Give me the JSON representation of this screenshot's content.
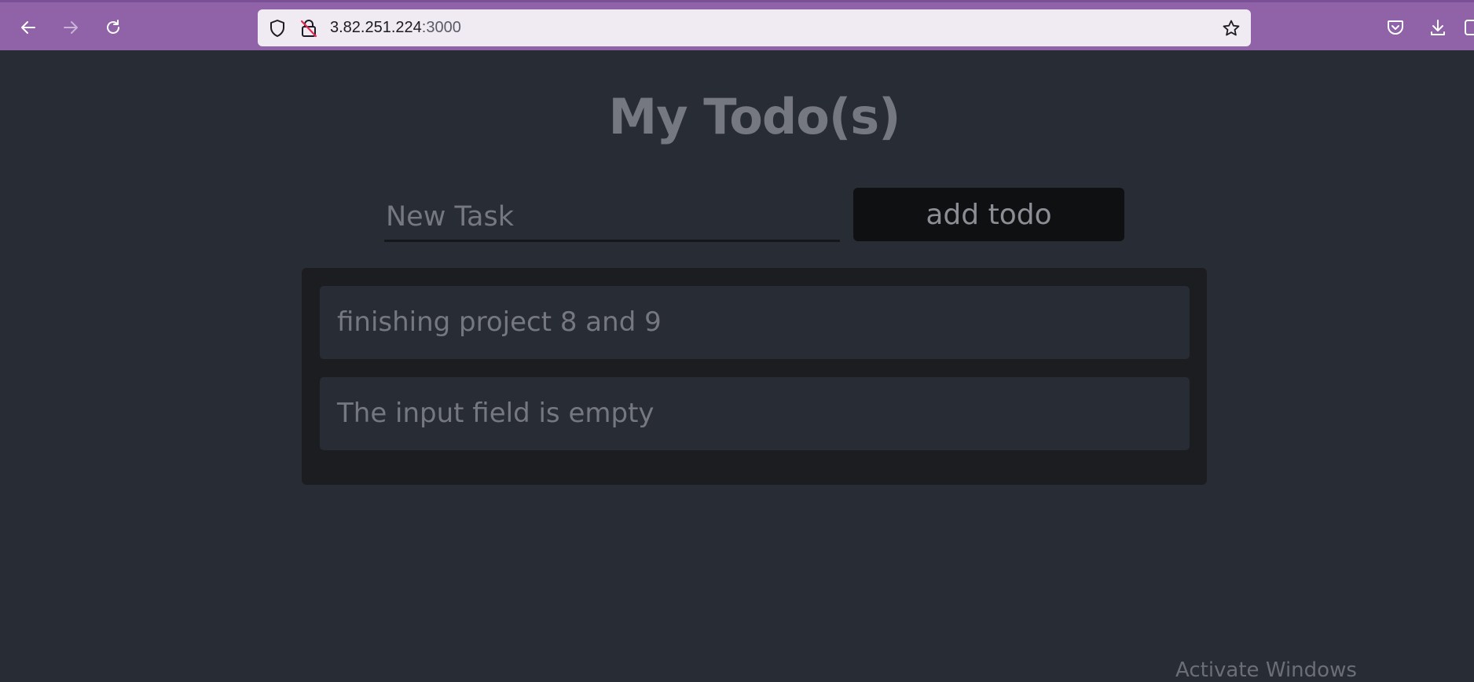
{
  "browser": {
    "url_host": "3.82.251.224",
    "url_port": ":3000",
    "accent_color": "#9062a8",
    "icons": [
      "back-arrow-icon",
      "forward-arrow-icon",
      "reload-icon",
      "shield-icon",
      "insecure-lock-icon",
      "star-icon",
      "pocket-icon",
      "download-icon"
    ]
  },
  "app": {
    "title": "My Todo(s)",
    "input": {
      "value": "New Task",
      "placeholder": "New Task"
    },
    "add_button_label": "add todo",
    "todos": [
      {
        "text": "finishing project 8 and 9"
      },
      {
        "text": "The input field is empty"
      }
    ]
  },
  "os": {
    "watermark": "Activate Windows"
  }
}
